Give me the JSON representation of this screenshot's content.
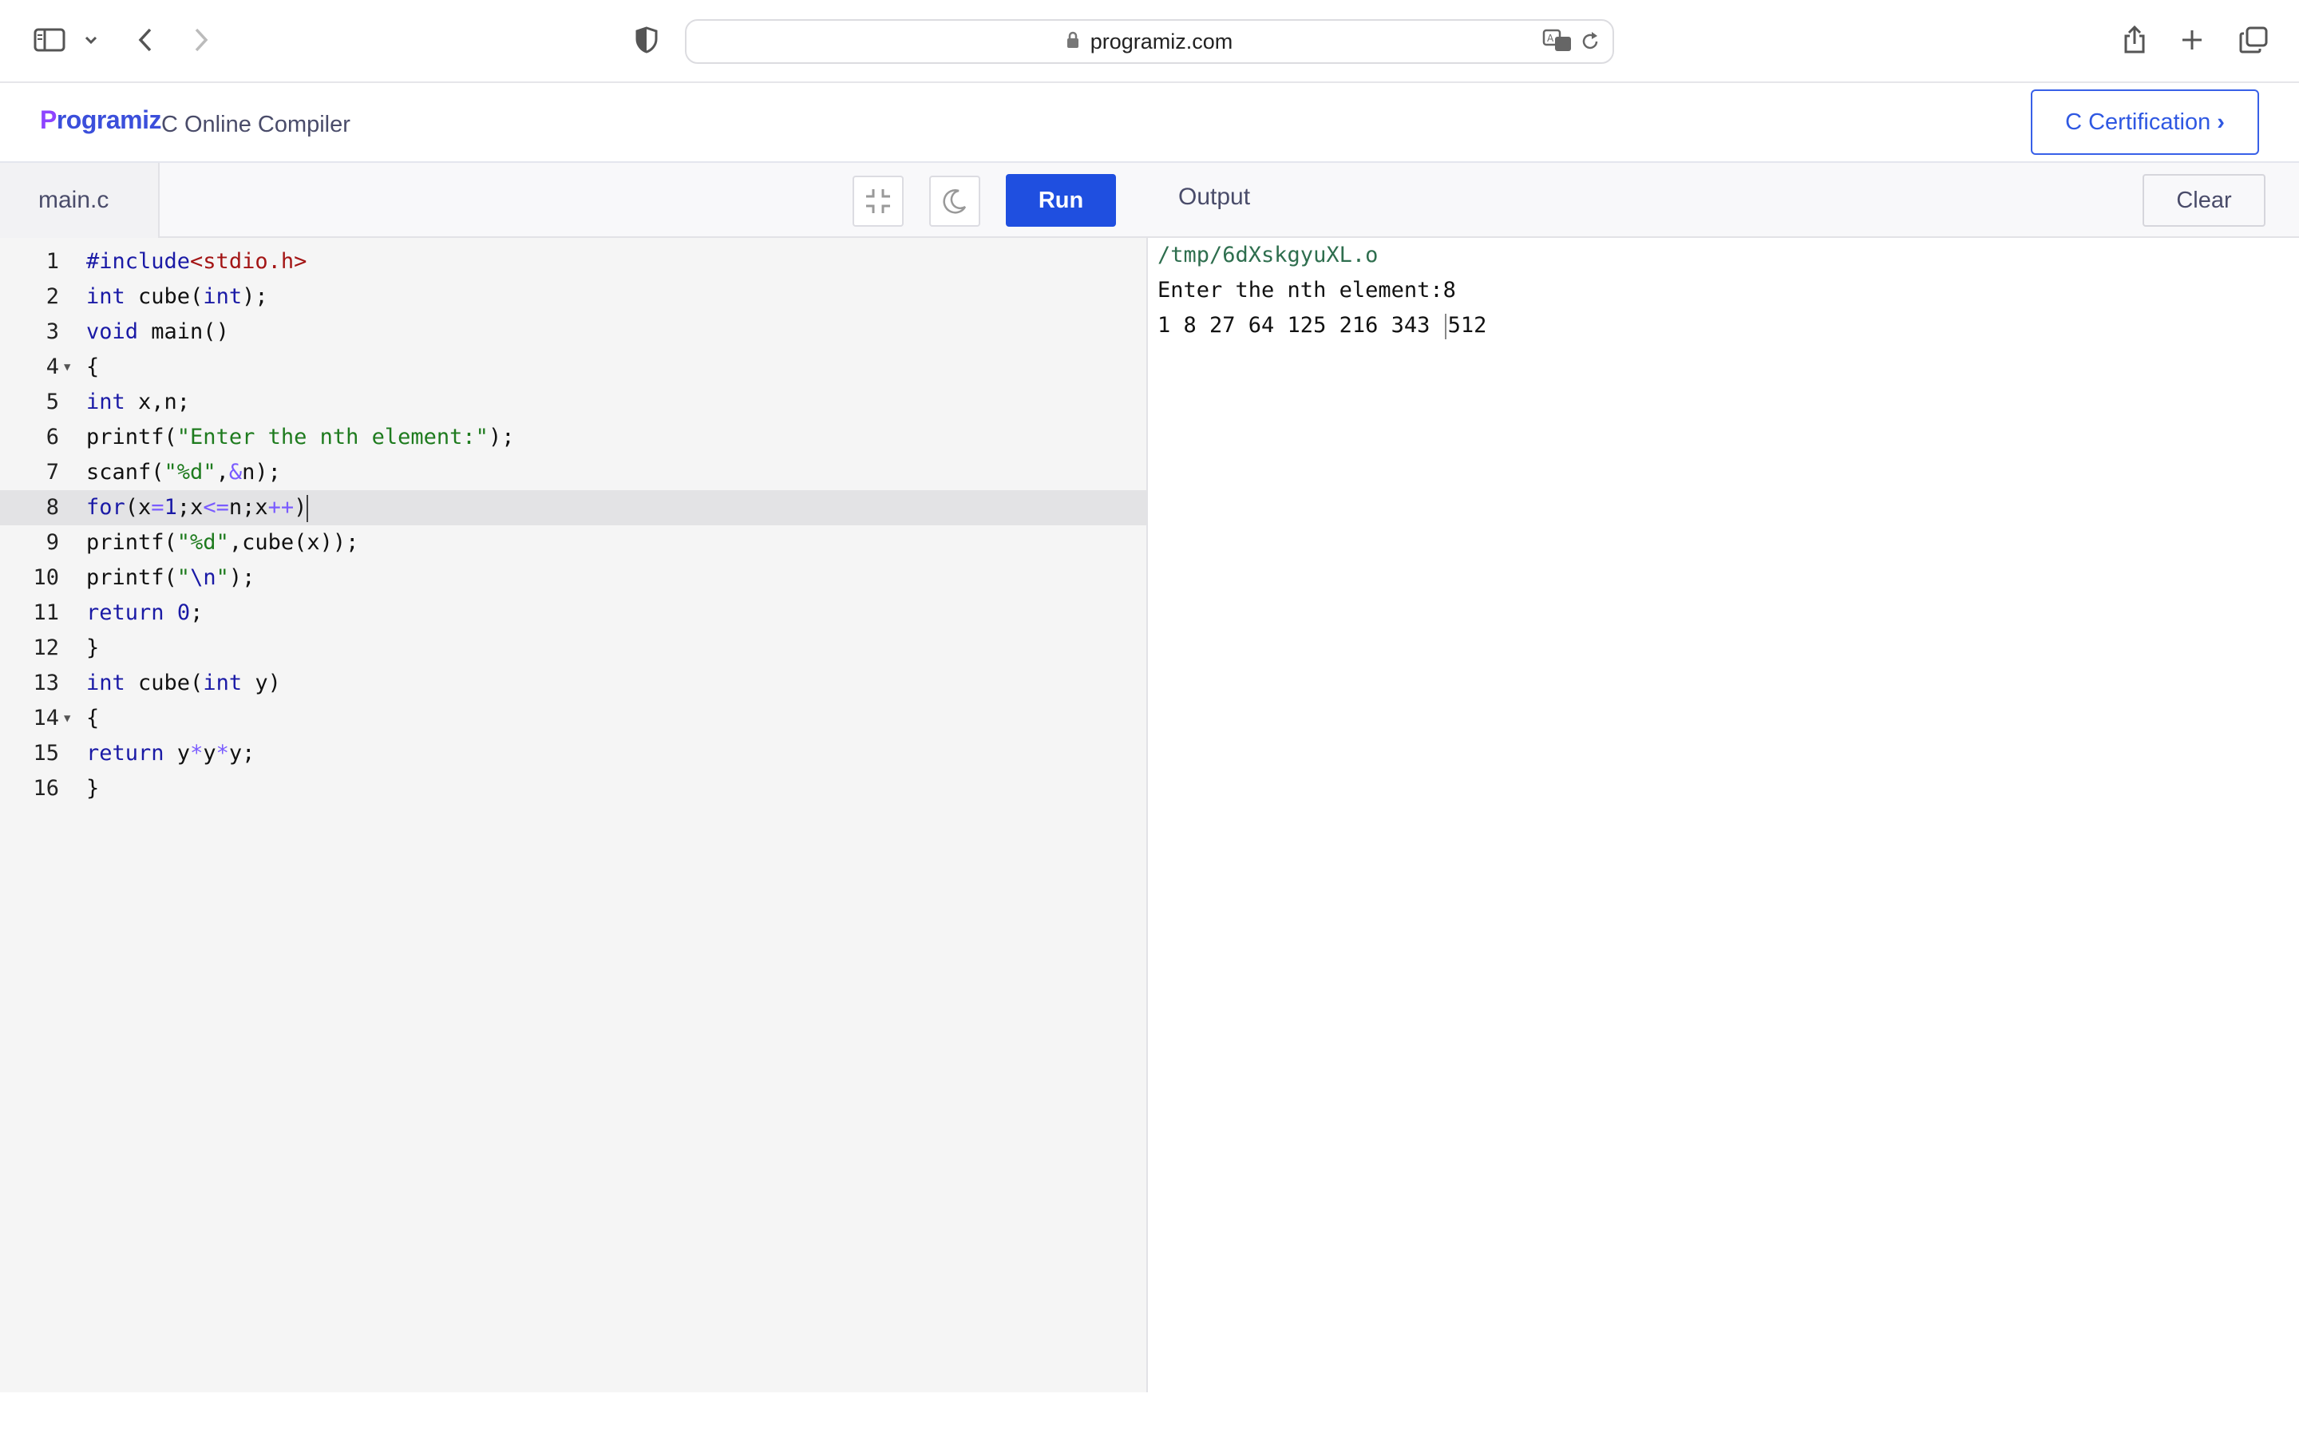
{
  "browser": {
    "url": "programiz.com"
  },
  "header": {
    "logo_text": "rogramiz",
    "logo_mark": "P",
    "title": "C Online Compiler",
    "cert_button": "C Certification"
  },
  "editor": {
    "file_tab": "main.c",
    "run_label": "Run",
    "active_line": 8,
    "lines": [
      {
        "n": "1"
      },
      {
        "n": "2"
      },
      {
        "n": "3"
      },
      {
        "n": "4"
      },
      {
        "n": "5"
      },
      {
        "n": "6"
      },
      {
        "n": "7"
      },
      {
        "n": "8"
      },
      {
        "n": "9"
      },
      {
        "n": "10"
      },
      {
        "n": "11"
      },
      {
        "n": "12"
      },
      {
        "n": "13"
      },
      {
        "n": "14"
      },
      {
        "n": "15"
      },
      {
        "n": "16"
      }
    ],
    "code": {
      "l1_a": "#include",
      "l1_b": "<stdio.h>",
      "l2_a": "int",
      "l2_b": " cube(",
      "l2_c": "int",
      "l2_d": ");",
      "l3_a": "void",
      "l3_b": " main()",
      "l4": "{",
      "l5_a": "int",
      "l5_b": " x,n;",
      "l6_a": "printf(",
      "l6_b": "\"Enter the nth element:\"",
      "l6_c": ");",
      "l7_a": "scanf(",
      "l7_b": "\"%d\"",
      "l7_c": ",",
      "l7_d": "&",
      "l7_e": "n);",
      "l8_a": "for",
      "l8_b": "(x",
      "l8_c": "=",
      "l8_d": "1",
      "l8_e": ";x",
      "l8_f": "<=",
      "l8_g": "n;x",
      "l8_h": "++",
      "l8_i": ")",
      "l9_a": "printf(",
      "l9_b": "\"%d\"",
      "l9_c": ",cube(x));",
      "l10_a": "printf(",
      "l10_b": "\"",
      "l10_c": "\\n",
      "l10_d": "\"",
      "l10_e": ");",
      "l11_a": "return",
      "l11_b": " ",
      "l11_c": "0",
      "l11_d": ";",
      "l12": "}",
      "l13_a": "int",
      "l13_b": " cube(",
      "l13_c": "int",
      "l13_d": " y)",
      "l14": "{",
      "l15_a": "return",
      "l15_b": " y",
      "l15_c": "*",
      "l15_d": "y",
      "l15_e": "*",
      "l15_f": "y;",
      "l16": "}"
    }
  },
  "output": {
    "label": "Output",
    "clear_label": "Clear",
    "path": "/tmp/6dXskgyuXL.o",
    "prompt_line": "Enter the nth element:8",
    "result_a": "1 8 27 64 125 216 343 ",
    "result_b": "512"
  },
  "icons": {
    "sidebar": "sidebar-icon",
    "back": "chevron-left-icon",
    "forward": "chevron-right-icon",
    "shield": "shield-icon",
    "share": "share-icon",
    "new_tab": "plus-icon",
    "tabs": "tabs-icon",
    "collapse": "collapse-icon",
    "theme": "moon-icon"
  },
  "colors": {
    "accent": "#1f4fe0",
    "keyword": "#1a1aa6",
    "string": "#1e7b1e"
  }
}
